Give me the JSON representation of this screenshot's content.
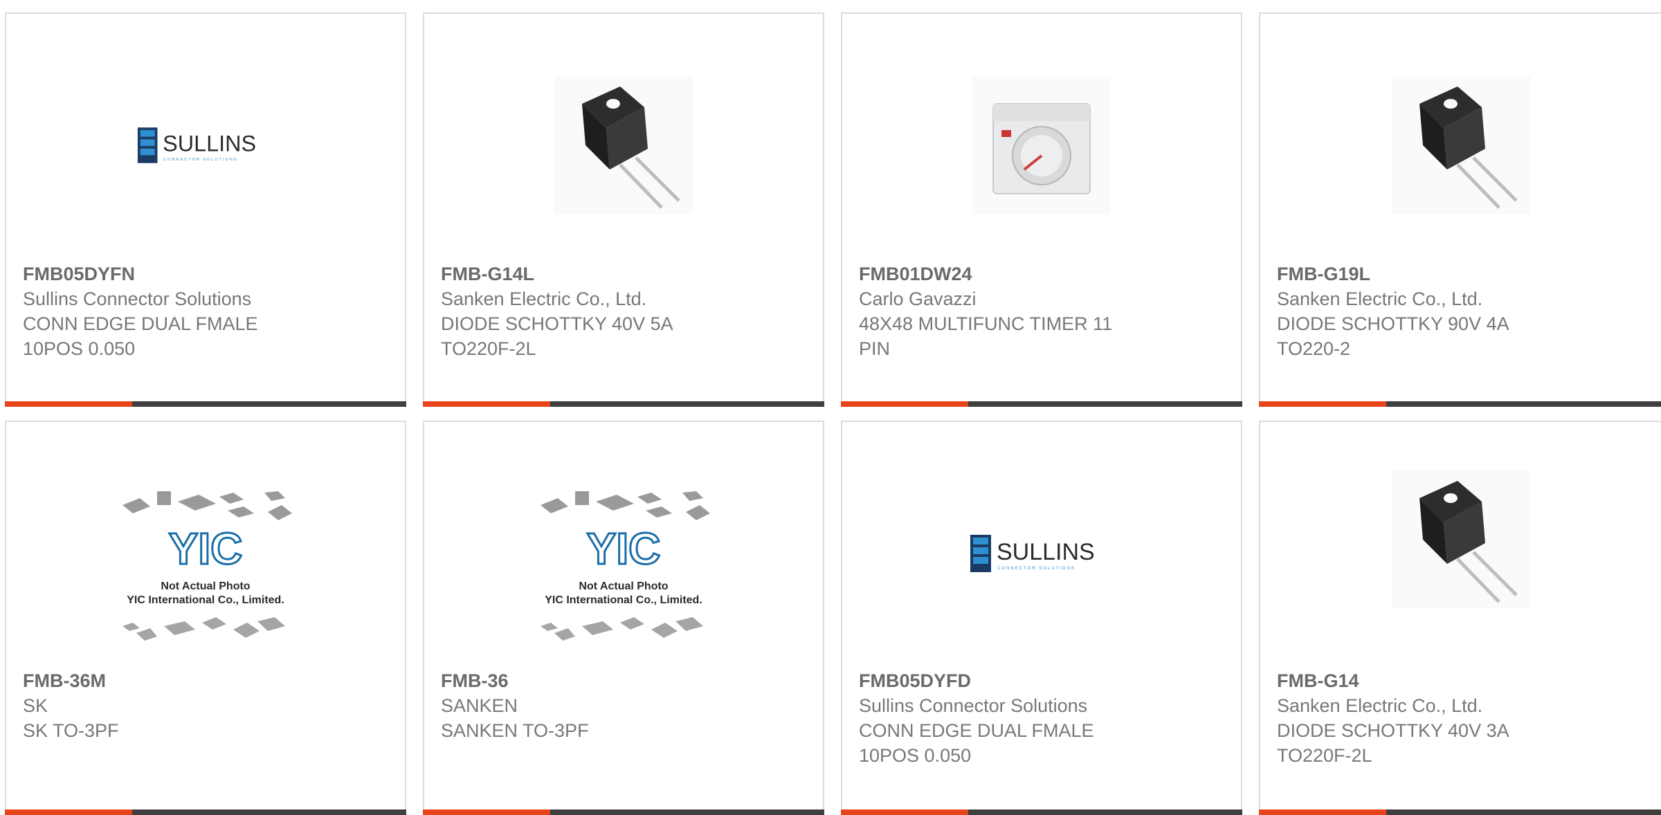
{
  "products": [
    {
      "part_number": "FMB05DYFN",
      "manufacturer": "Sullins Connector Solutions",
      "description_line1": "CONN EDGE DUAL FMALE",
      "description_line2": "10POS 0.050",
      "image": "sullins-logo",
      "logo_text": "SULLINS",
      "logo_subtext": "CONNECTOR SOLUTIONS"
    },
    {
      "part_number": "FMB-G14L",
      "manufacturer": "Sanken Electric Co., Ltd.",
      "description_line1": "DIODE SCHOTTKY 40V 5A",
      "description_line2": "TO220F-2L",
      "image": "to220-diode-photo"
    },
    {
      "part_number": "FMB01DW24",
      "manufacturer": "Carlo Gavazzi",
      "description_line1": "48X48 MULTIFUNC TIMER 11",
      "description_line2": "PIN",
      "image": "timer-relay-photo"
    },
    {
      "part_number": "FMB-G19L",
      "manufacturer": "Sanken Electric Co., Ltd.",
      "description_line1": "DIODE SCHOTTKY 90V 4A",
      "description_line2": "TO220-2",
      "image": "to220-diode-photo"
    },
    {
      "part_number": "FMB-36M",
      "manufacturer": "SK",
      "description_line1": "SK TO-3PF",
      "description_line2": "",
      "image": "yic-placeholder",
      "placeholder_line1": "Not Actual Photo",
      "placeholder_line2": "YIC International Co., Limited."
    },
    {
      "part_number": "FMB-36",
      "manufacturer": "SANKEN",
      "description_line1": "SANKEN TO-3PF",
      "description_line2": "",
      "image": "yic-placeholder",
      "placeholder_line1": "Not Actual Photo",
      "placeholder_line2": "YIC International Co., Limited."
    },
    {
      "part_number": "FMB05DYFD",
      "manufacturer": "Sullins Connector Solutions",
      "description_line1": "CONN EDGE DUAL FMALE",
      "description_line2": "10POS 0.050",
      "image": "sullins-logo",
      "logo_text": "SULLINS",
      "logo_subtext": "CONNECTOR SOLUTIONS"
    },
    {
      "part_number": "FMB-G14",
      "manufacturer": "Sanken Electric Co., Ltd.",
      "description_line1": "DIODE SCHOTTKY 40V 3A",
      "description_line2": "TO220F-2L",
      "image": "to220-diode-photo"
    }
  ],
  "colors": {
    "accent": "#e8441c",
    "bar": "#3f3f3f",
    "border": "#dcdcdc",
    "text": "#777777",
    "logo_blue": "#1a6ea8",
    "logo_dark": "#2b2b2b"
  }
}
